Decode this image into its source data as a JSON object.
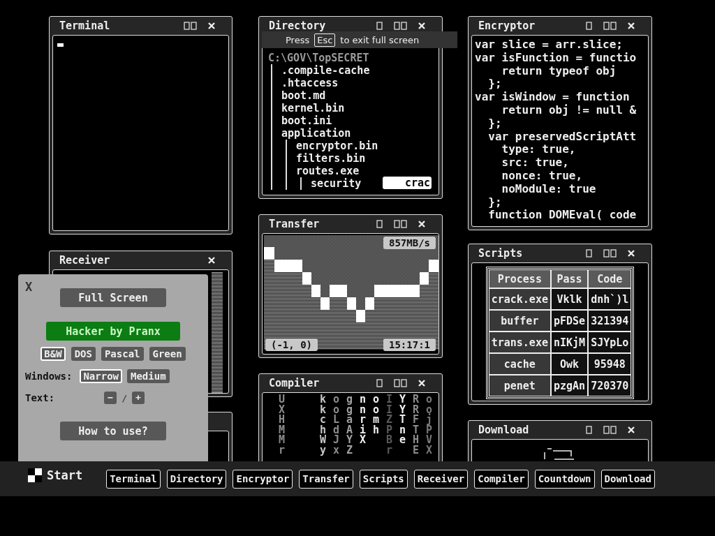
{
  "windows": [
    {
      "kind": "terminal",
      "title": "Terminal"
    },
    {
      "kind": "directory",
      "title": "Directory",
      "tree": {
        "name": "C:\\GOV\\TopSECRET",
        "children": [
          {
            "name": ".compile-cache"
          },
          {
            "name": ".htaccess"
          },
          {
            "name": "boot.md"
          },
          {
            "name": "kernel.bin"
          },
          {
            "name": "boot.ini"
          },
          {
            "name": "application",
            "children": [
              {
                "name": "encryptor.bin"
              },
              {
                "name": "filters.bin"
              },
              {
                "name": "routes.exe",
                "children": [
                  {
                    "name": "security"
                  }
                ]
              }
            ]
          }
        ]
      },
      "command_input": {
        "value": "crac"
      }
    },
    {
      "kind": "code",
      "title": "Encryptor",
      "lines": [
        "var slice = arr.slice;",
        "var isFunction = functio",
        "    return typeof obj",
        "  };",
        "var isWindow = function",
        "    return obj != null &",
        "  };",
        "  var preservedScriptAtt",
        "    type: true,",
        "    src: true,",
        "    nonce: true,",
        "    noModule: true",
        "  };",
        "  function DOMEval( code"
      ]
    },
    {
      "kind": "receiver",
      "title": "Receiver"
    },
    {
      "kind": "transfer",
      "title": "Transfer",
      "rate": "857MB/s",
      "coords": "(-1, 0)",
      "time": "15:17:1"
    },
    {
      "kind": "table",
      "title": "Scripts",
      "columns": [
        "Process",
        "Pass",
        "Code"
      ],
      "rows": [
        [
          "crack.exe",
          "Vklk",
          "dnh`)l"
        ],
        [
          "buffer",
          "pFDSe",
          "321394"
        ],
        [
          "trans.exe",
          "nIKjM",
          "SJYpLo"
        ],
        [
          "cache",
          "Owk",
          "95948"
        ],
        [
          "penet",
          "pzgAn",
          "720370"
        ]
      ]
    },
    {
      "kind": "matrix",
      "title": "Compiler",
      "columns": [
        {
          "text": "UXHMMr",
          "color": "#8c8c8c"
        },
        {
          "text": "kkchWy",
          "color": "#c8c8c8"
        },
        {
          "text": "ooLdJx",
          "color": "#8c8c8c"
        },
        {
          "text": "ggaAYZ",
          "color": "#a0a0a0"
        },
        {
          "text": "nnriX",
          "color": "#f0f0f0"
        },
        {
          "text": "oomh",
          "color": "#f0f0f0"
        },
        {
          "text": "IIZPBr",
          "color": "#5a5a5a"
        },
        {
          "text": "YYTne",
          "color": "#f0f0f0"
        },
        {
          "text": "RRFTHE",
          "color": "#8c8c8c"
        },
        {
          "text": "oojPVX",
          "color": "#787878"
        }
      ]
    },
    {
      "kind": "download",
      "title": "Download"
    },
    {
      "kind": "blank"
    }
  ],
  "settings": {
    "close": "X",
    "full_screen": "Full Screen",
    "credit": "Hacker by Pranx",
    "themes": [
      {
        "label": "B&W",
        "selected": true
      },
      {
        "label": "DOS",
        "selected": false
      },
      {
        "label": "Pascal",
        "selected": false
      },
      {
        "label": "Green",
        "selected": false
      }
    ],
    "window_sizes": {
      "label": "Windows:",
      "options": [
        {
          "label": "Narrow",
          "selected": true
        },
        {
          "label": "Medium",
          "selected": false
        }
      ]
    },
    "text_size": {
      "label": "Text:",
      "decrease": "−",
      "separator": "/",
      "increase": "+"
    },
    "help": "How to use?"
  },
  "fullscreen_notice": {
    "before": "Press",
    "key": "Esc",
    "after": "to exit full screen"
  },
  "taskbar": {
    "start": "Start",
    "buttons": [
      "Terminal",
      "Directory",
      "Encryptor",
      "Transfer",
      "Scripts",
      "Receiver",
      "Compiler",
      "Countdown",
      "Download"
    ]
  }
}
